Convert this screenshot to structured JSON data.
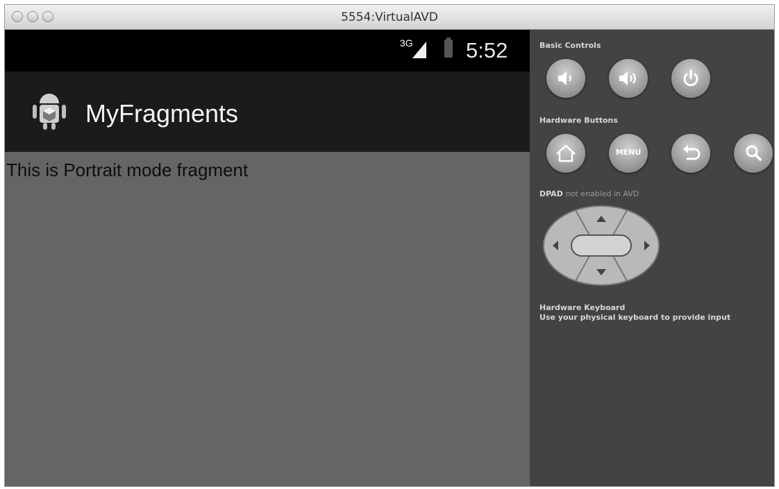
{
  "window": {
    "title": "5554:VirtualAVD"
  },
  "device": {
    "status_bar": {
      "network": "3G",
      "time": "5:52"
    },
    "action_bar": {
      "app_title": "MyFragments",
      "icon": "android-robot-icon"
    },
    "content": {
      "text": "This is Portrait mode fragment"
    }
  },
  "controls": {
    "basic_controls": {
      "label": "Basic Controls",
      "buttons": [
        "volume-down-icon",
        "volume-up-icon",
        "power-icon"
      ]
    },
    "hardware_buttons": {
      "label": "Hardware Buttons",
      "buttons": [
        "home-icon",
        "menu-button",
        "back-icon",
        "search-icon"
      ],
      "menu_label": "MENU"
    },
    "dpad": {
      "label_bold": "DPAD",
      "label_rest": "not enabled in AVD"
    },
    "keyboard": {
      "label": "Hardware Keyboard",
      "hint": "Use your physical keyboard to provide input"
    }
  },
  "colors": {
    "device_background": "#656565",
    "action_bar": "#1b1b1b",
    "controls_background": "#434343"
  }
}
